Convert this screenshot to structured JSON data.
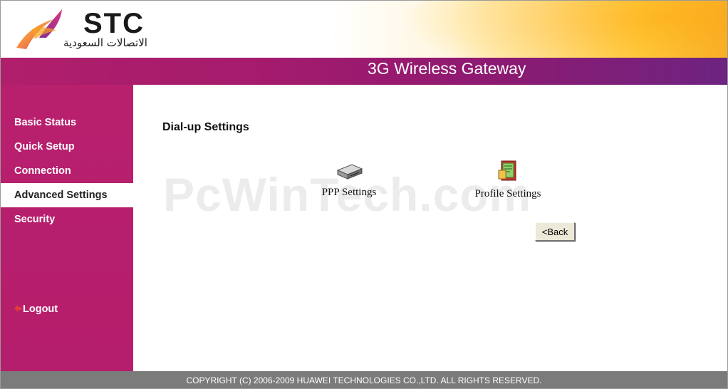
{
  "header": {
    "logo_text": "STC",
    "logo_arabic": "الاتصالات السعودية",
    "product_title": "3G Wireless Gateway"
  },
  "sidebar": {
    "items": [
      {
        "label": "Basic Status",
        "active": false
      },
      {
        "label": "Quick Setup",
        "active": false
      },
      {
        "label": "Connection",
        "active": false
      },
      {
        "label": "Advanced Settings",
        "active": true
      },
      {
        "label": "Security",
        "active": false
      }
    ],
    "logout_label": "Logout"
  },
  "main": {
    "page_title": "Dial-up Settings",
    "watermark": "PcWinTech.com",
    "tiles": [
      {
        "label": "PPP Settings",
        "icon": "hard-drive-icon"
      },
      {
        "label": "Profile Settings",
        "icon": "profile-book-icon"
      }
    ],
    "back_label": "<Back"
  },
  "footer": {
    "copyright": "COPYRIGHT (C) 2006-2009 HUAWEI TECHNOLOGIES CO.,LTD. ALL RIGHTS RESERVED."
  },
  "colors": {
    "sidebar": "#b8206e",
    "titlebar_start": "#b01f6b",
    "titlebar_end": "#6d2480",
    "footer": "#7b7b7b"
  }
}
